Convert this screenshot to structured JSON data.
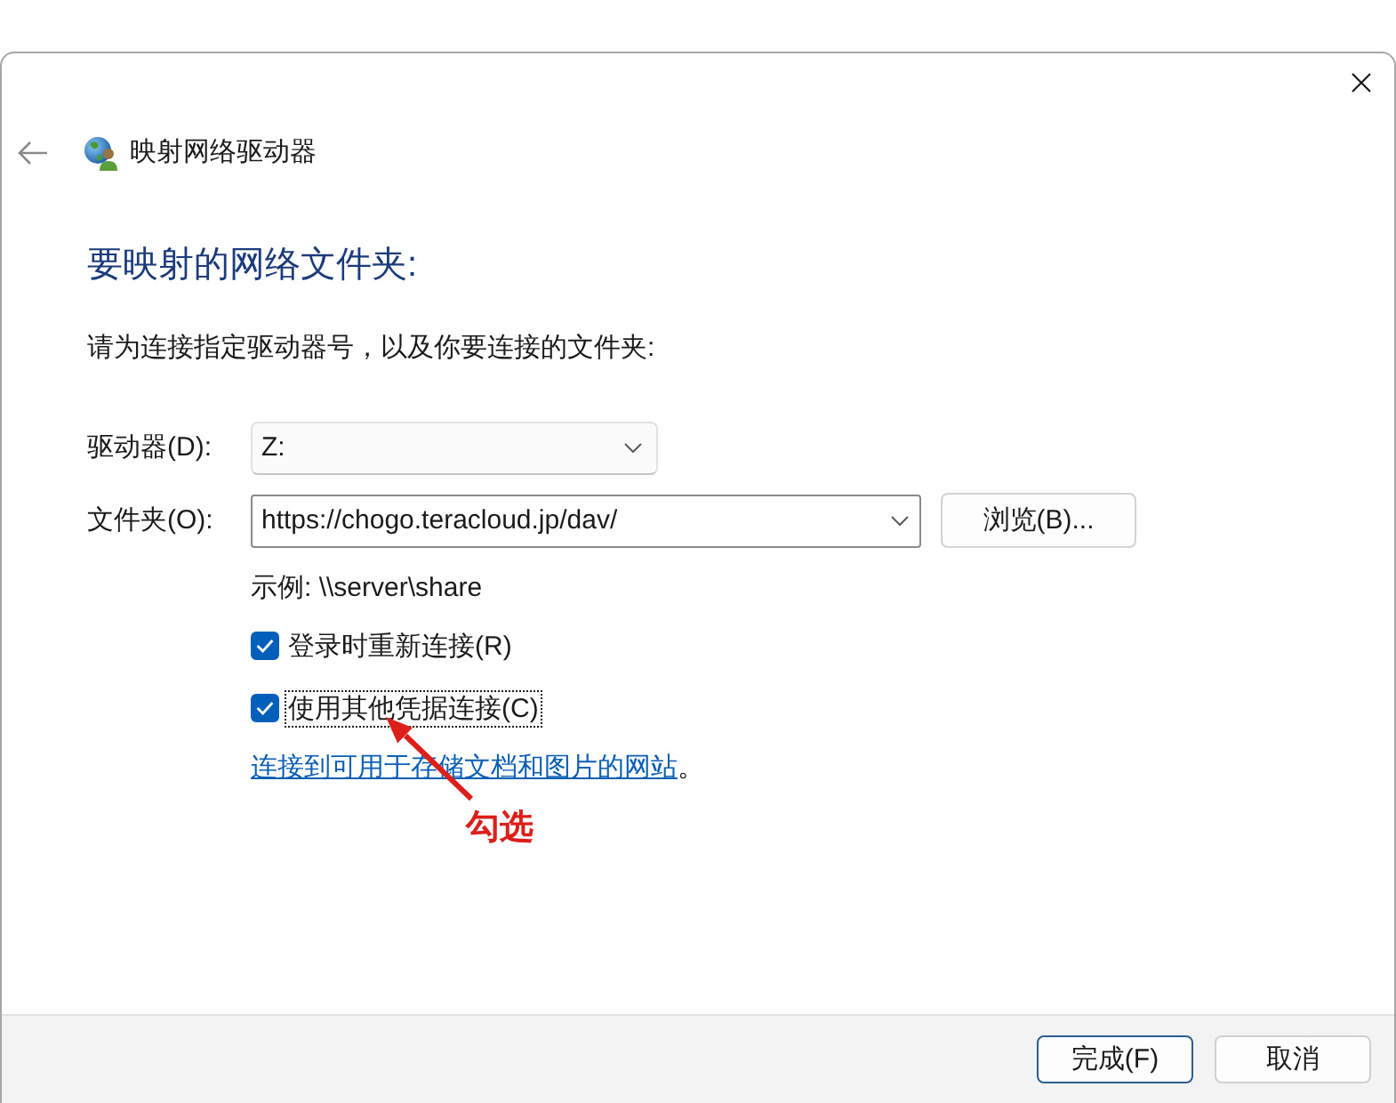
{
  "window": {
    "title": "映射网络驱动器"
  },
  "heading": "要映射的网络文件夹:",
  "instruction": "请为连接指定驱动器号，以及你要连接的文件夹:",
  "fields": [
    {
      "kind": "dropdown",
      "label": "驱动器(D):",
      "value": "Z:"
    },
    {
      "kind": "combo",
      "label": "文件夹(O):",
      "value": "https://chogo.teracloud.jp/dav/",
      "button": "浏览(B)..."
    }
  ],
  "example": "示例: \\\\server\\share",
  "options": [
    {
      "label": "登录时重新连接(R)",
      "checked": true,
      "focused": false
    },
    {
      "label": "使用其他凭据连接(C)",
      "checked": true,
      "focused": true
    }
  ],
  "link": {
    "text": "连接到可用于存储文档和图片的网站",
    "suffix": "。"
  },
  "annotation": {
    "text": "勾选"
  },
  "buttons": [
    {
      "label": "完成(F)",
      "default": true
    },
    {
      "label": "取消",
      "default": false
    }
  ]
}
